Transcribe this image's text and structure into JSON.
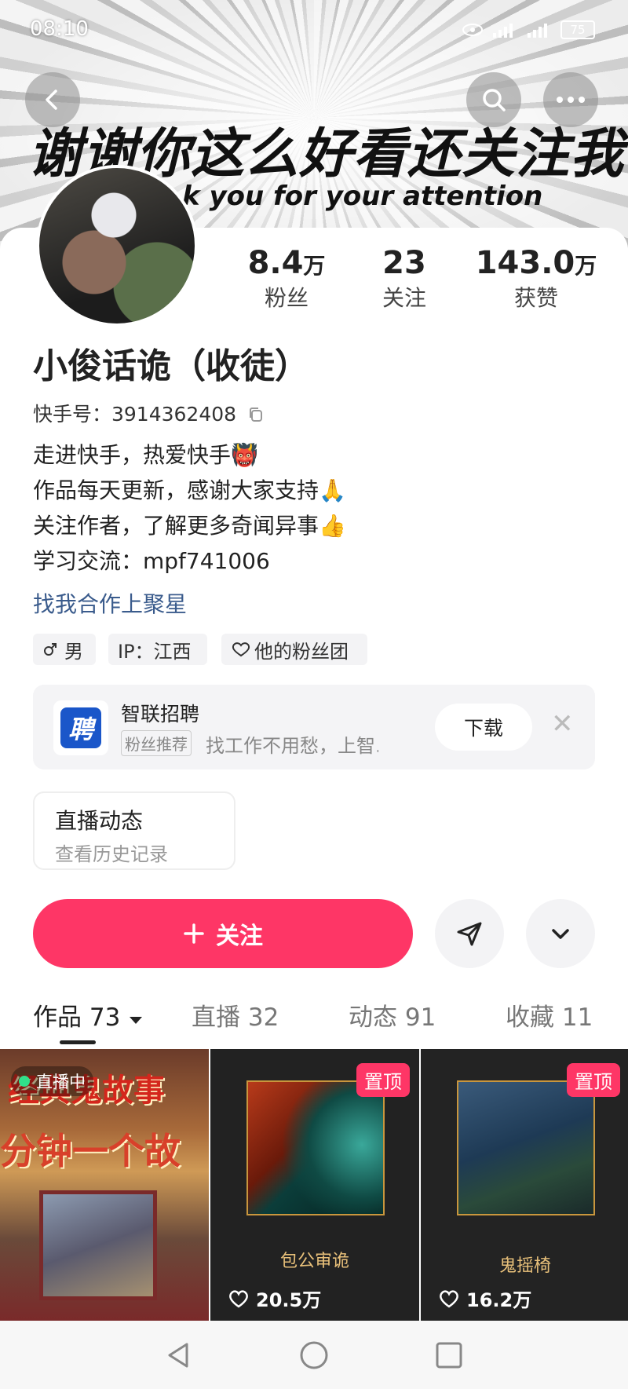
{
  "status_bar": {
    "time": "08:10",
    "battery": "75"
  },
  "banner": {
    "title": "谢谢你这么好看还关注我",
    "subtitle": "k you for your attention"
  },
  "icons": {
    "back": "back-arrow-icon",
    "search": "search-icon",
    "more": "more-dots-icon"
  },
  "profile": {
    "stats": [
      {
        "num": "8.4",
        "unit": "万",
        "label": "粉丝"
      },
      {
        "num": "23",
        "unit": "",
        "label": "关注"
      },
      {
        "num": "143.0",
        "unit": "万",
        "label": "获赞"
      }
    ],
    "name": "小俊话诡（收徒）",
    "id_label": "快手号：3914362408",
    "bio": [
      "走进快手，热爱快手👹",
      "作品每天更新，感谢大家支持🙏",
      "关注作者，了解更多奇闻异事👍",
      "学习交流：mpf741006"
    ],
    "coop_link": "找我合作上聚星",
    "tags": {
      "gender": "男",
      "ip": "IP：江西",
      "fans_group": "他的粉丝团"
    }
  },
  "ad": {
    "logo_text": "聘",
    "name": "智联招聘",
    "badge": "粉丝推荐",
    "desc": "找工作不用愁，上智…",
    "download": "下载"
  },
  "live_card": {
    "title": "直播动态",
    "subtitle": "查看历史记录"
  },
  "actions": {
    "follow": "关注"
  },
  "tabs": [
    {
      "label": "作品 73"
    },
    {
      "label": "直播 32"
    },
    {
      "label": "动态 91"
    },
    {
      "label": "收藏 11"
    }
  ],
  "grid": [
    {
      "live_badge": "直播中",
      "text1": "经典鬼故事",
      "text2": "分钟一个故"
    },
    {
      "pin": "置顶",
      "title": "包公审诡",
      "likes": "20.5万"
    },
    {
      "pin": "置顶",
      "title": "鬼摇椅",
      "likes": "16.2万"
    }
  ],
  "colors": {
    "accent": "#fe3666",
    "link": "#3a5b8c"
  }
}
